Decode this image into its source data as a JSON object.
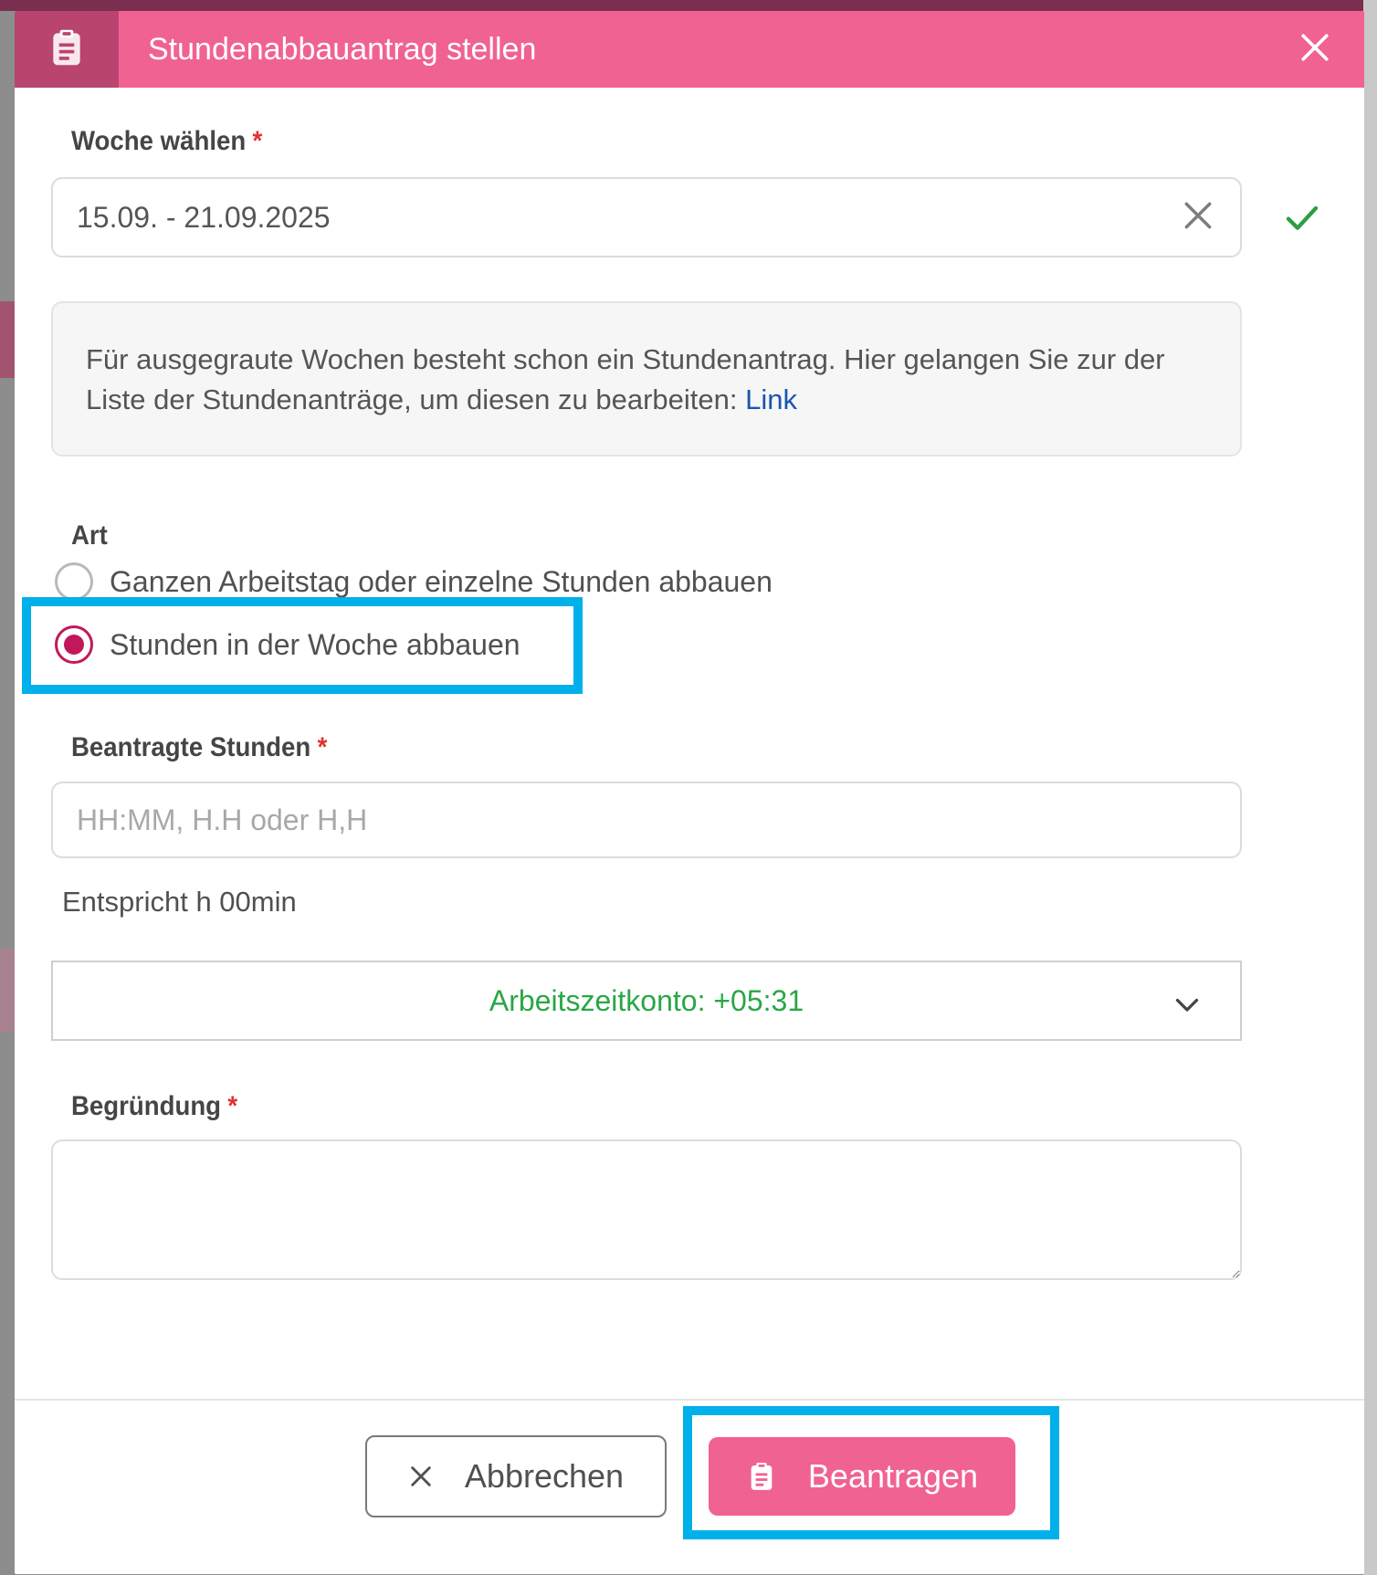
{
  "dialog": {
    "title": "Stundenabbauantrag stellen",
    "header_icon": "clipboard-icon",
    "close_icon": "close-icon"
  },
  "week": {
    "label": "Woche wählen",
    "required_mark": "*",
    "value": "15.09. - 21.09.2025"
  },
  "info": {
    "text": "Für ausgegraute Wochen besteht schon ein Stundenantrag. Hier gelangen Sie zur der Liste der Stundenanträge, um diesen zu bearbeiten: ",
    "link_text": "Link"
  },
  "art": {
    "label": "Art",
    "options": [
      {
        "label": "Ganzen Arbeitstag oder einzelne Stunden abbauen",
        "checked": false
      },
      {
        "label": "Stunden in der Woche abbauen",
        "checked": true
      }
    ]
  },
  "hours": {
    "label": "Beantragte Stunden",
    "required_mark": "*",
    "placeholder": "HH:MM, H.H oder H,H",
    "value": "",
    "helper": "Entspricht h 00min"
  },
  "account": {
    "text": "Arbeitszeitkonto: +05:31"
  },
  "reason": {
    "label": "Begründung",
    "required_mark": "*",
    "value": ""
  },
  "footer": {
    "cancel_label": "Abbrechen",
    "submit_label": "Beantragen"
  },
  "colors": {
    "header": "#f06292",
    "header_icon_box": "#b9446f",
    "radio_checked": "#c2185b",
    "account_text": "#28a745",
    "highlight": "#00b0ea",
    "link": "#1a56b0",
    "required": "#e03131"
  }
}
